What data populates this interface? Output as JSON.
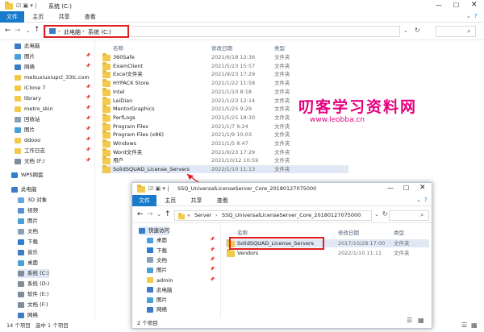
{
  "window": {
    "title": "系统 (C:)",
    "tabs": [
      "文件",
      "主页",
      "共享",
      "查看"
    ],
    "breadcrumb": [
      "此电脑",
      "系统 (C:)"
    ],
    "search_placeholder": ""
  },
  "sidebar": {
    "items": [
      {
        "label": "此电脑",
        "icon": "computer-icon"
      },
      {
        "label": "图片",
        "icon": "pictures-icon"
      },
      {
        "label": "网络",
        "icon": "network-icon"
      },
      {
        "label": "meituxiuxiupcl_33lc.com",
        "icon": "folder-icon"
      },
      {
        "label": "iClone 7",
        "icon": "folder-icon"
      },
      {
        "label": "library",
        "icon": "folder-icon"
      },
      {
        "label": "metro_skin",
        "icon": "folder-icon"
      },
      {
        "label": "回收站",
        "icon": "recycle-bin-icon"
      },
      {
        "label": "图片",
        "icon": "pictures-icon"
      },
      {
        "label": "ddooo",
        "icon": "folder-icon"
      },
      {
        "label": "工作日志",
        "icon": "folder-icon"
      },
      {
        "label": "文档 (F:)",
        "icon": "drive-icon"
      },
      {
        "label": "WPS网盘",
        "icon": "cloud-icon"
      },
      {
        "label": "此电脑",
        "icon": "computer-icon"
      },
      {
        "label": "3D 对象",
        "icon": "3d-objects-icon"
      },
      {
        "label": "视频",
        "icon": "videos-icon"
      },
      {
        "label": "图片",
        "icon": "pictures-icon"
      },
      {
        "label": "文档",
        "icon": "documents-icon"
      },
      {
        "label": "下载",
        "icon": "downloads-icon"
      },
      {
        "label": "音乐",
        "icon": "music-icon"
      },
      {
        "label": "桌面",
        "icon": "desktop-icon"
      },
      {
        "label": "系统 (C:)",
        "icon": "drive-icon"
      },
      {
        "label": "系统 (D:)",
        "icon": "drive-icon"
      },
      {
        "label": "软件 (E:)",
        "icon": "drive-icon"
      },
      {
        "label": "文档 (F:)",
        "icon": "drive-icon"
      },
      {
        "label": "网络",
        "icon": "network-icon"
      }
    ]
  },
  "columns": {
    "name": "名称",
    "date": "修改日期",
    "type": "类型"
  },
  "files": [
    {
      "name": "360Safe",
      "date": "2021/6/18 12:36",
      "type": "文件夹"
    },
    {
      "name": "ExamClient",
      "date": "2021/5/23 15:57",
      "type": "文件夹"
    },
    {
      "name": "Excel文件夹",
      "date": "2021/9/23 17:29",
      "type": "文件夹"
    },
    {
      "name": "HYPACK Store",
      "date": "2021/1/22 11:58",
      "type": "文件夹"
    },
    {
      "name": "Intel",
      "date": "2021/1/10 8:18",
      "type": "文件夹"
    },
    {
      "name": "LeiDian",
      "date": "2021/1/23 12:14",
      "type": "文件夹"
    },
    {
      "name": "MentorGraphics",
      "date": "2021/5/25 9:29",
      "type": "文件夹"
    },
    {
      "name": "PerfLogs",
      "date": "2021/5/25 18:30",
      "type": "文件夹"
    },
    {
      "name": "Program Files",
      "date": "2021/1/7 9:24",
      "type": "文件夹"
    },
    {
      "name": "Program Files (x86)",
      "date": "2021/1/9 10:03",
      "type": "文件夹"
    },
    {
      "name": "Windows",
      "date": "2021/1/5 8:47",
      "type": "文件夹"
    },
    {
      "name": "Word文件夹",
      "date": "2021/9/23 17:29",
      "type": "文件夹"
    },
    {
      "name": "用户",
      "date": "2021/10/12 10:59",
      "type": "文件夹"
    },
    {
      "name": "SolidSQUAD_License_Servers",
      "date": "2022/1/10 11:13",
      "type": "文件夹"
    }
  ],
  "status": {
    "count": "14 个项目",
    "selected": "选中 1 个项目"
  },
  "watermark": {
    "title": "叨客学习资料网",
    "url": "www.leobba.cn"
  },
  "window2": {
    "title": "SSQ_UniversalLicenseServer_Core_20180127075000",
    "tabs": [
      "文件",
      "主页",
      "共享",
      "查看"
    ],
    "breadcrumb": [
      "Server",
      "SSQ_UniversalLicenseServer_Core_20180127075000"
    ],
    "sidebar": [
      {
        "label": "快速访问",
        "icon": "star-icon"
      },
      {
        "label": "桌面",
        "icon": "desktop-icon"
      },
      {
        "label": "下载",
        "icon": "downloads-icon"
      },
      {
        "label": "文档",
        "icon": "documents-icon"
      },
      {
        "label": "图片",
        "icon": "pictures-icon"
      },
      {
        "label": "admin",
        "icon": "folder-icon"
      },
      {
        "label": "此电脑",
        "icon": "computer-icon"
      },
      {
        "label": "图片",
        "icon": "pictures-icon"
      },
      {
        "label": "网络",
        "icon": "network-icon"
      }
    ],
    "columns": {
      "name": "名称",
      "date": "修改日期",
      "type": "类型"
    },
    "files": [
      {
        "name": "SolidSQUAD_License_Servers",
        "date": "2017/10/28 17:00",
        "type": "文件夹"
      },
      {
        "name": "Vendors",
        "date": "2022/1/10 11:11",
        "type": "文件夹"
      }
    ],
    "status": "2 个项目"
  },
  "colors": {
    "accent": "#1979ca",
    "highlight": "#e02020",
    "watermark": "#e5007e",
    "selection": "#dfe8f4"
  }
}
